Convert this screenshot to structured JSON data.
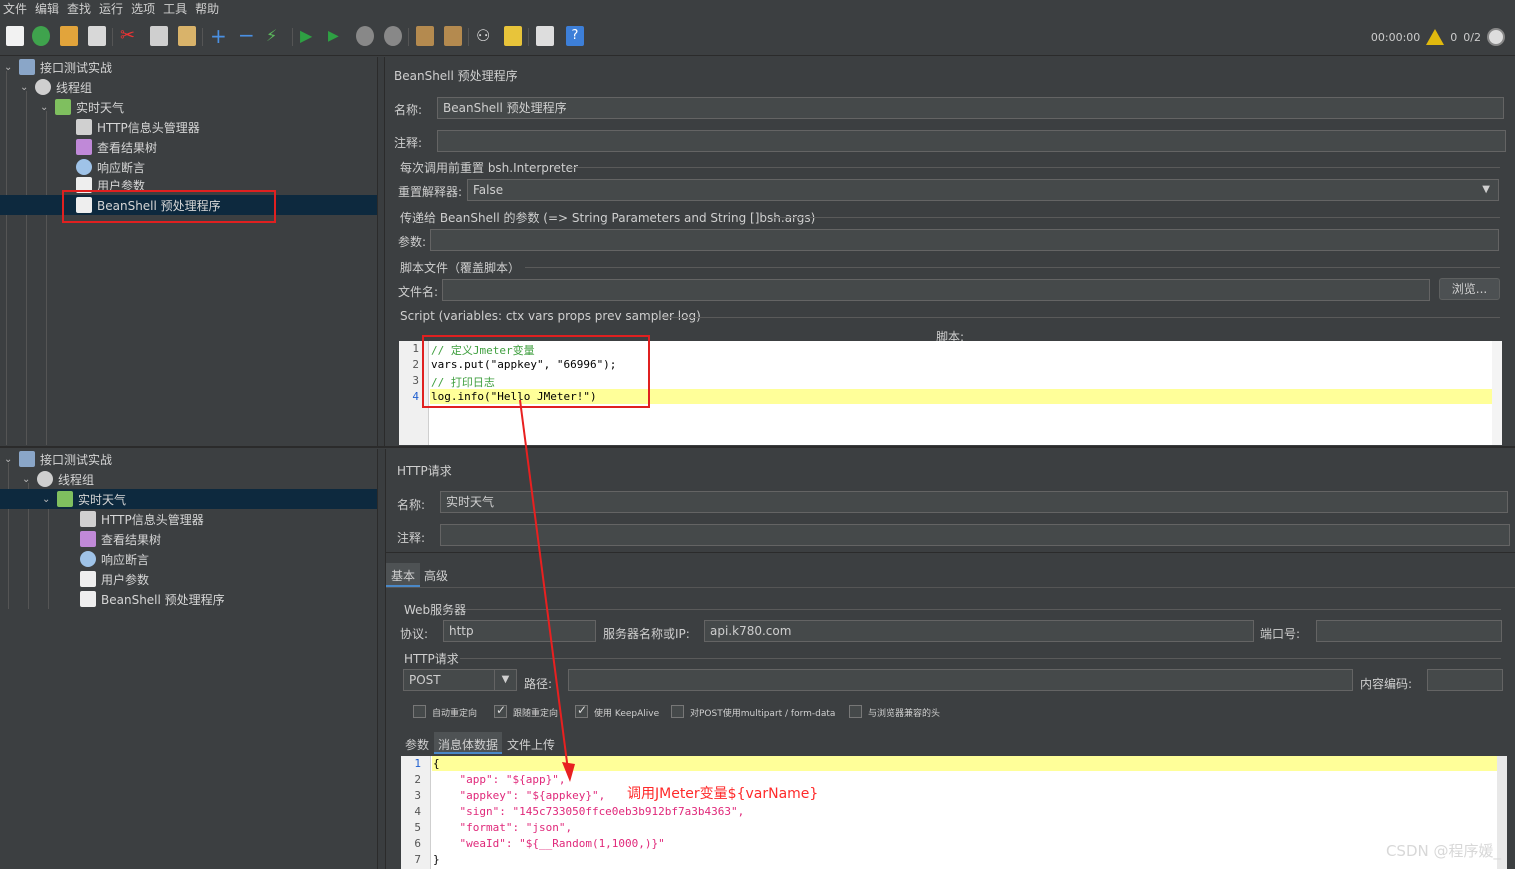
{
  "menu": [
    "文件",
    "编辑",
    "查找",
    "运行",
    "选项",
    "工具",
    "帮助"
  ],
  "toolbar": {
    "timer": "00:00:00",
    "warnings": "0",
    "threads": "0/2"
  },
  "top_tree": {
    "items": [
      {
        "label": "接口测试实战",
        "icon": "test-plan-icon"
      },
      {
        "label": "线程组",
        "icon": "gear-icon"
      },
      {
        "label": "实时天气",
        "icon": "pipette-icon"
      },
      {
        "label": "HTTP信息头管理器",
        "icon": "wrench-icon"
      },
      {
        "label": "查看结果树",
        "icon": "chart-icon"
      },
      {
        "label": "响应断言",
        "icon": "magnifier-icon"
      },
      {
        "label": "用户参数",
        "icon": "document-icon"
      },
      {
        "label": "BeanShell 预处理程序",
        "icon": "document-icon"
      }
    ]
  },
  "beanshell_panel": {
    "title": "BeanShell 预处理程序",
    "name_label": "名称:",
    "name_value": "BeanShell 预处理程序",
    "comment_label": "注释:",
    "reset_group": "每次调用前重置 bsh.Interpreter",
    "reset_label": "重置解释器:",
    "reset_value": "False",
    "params_group": "传递给 BeanShell 的参数 (=> String Parameters and String []bsh.args)",
    "params_label": "参数:",
    "file_group": "脚本文件（覆盖脚本）",
    "file_label": "文件名:",
    "browse_button": "浏览...",
    "script_group": "Script (variables: ctx vars props prev sampler log)",
    "script_label": "脚本:",
    "script_lines": [
      {
        "n": "1",
        "text": "// 定义Jmeter变量"
      },
      {
        "n": "2",
        "text": "vars.put(\"appkey\", \"66996\");"
      },
      {
        "n": "3",
        "text": "// 打印日志"
      },
      {
        "n": "4",
        "text": "log.info(\"Hello JMeter!\")"
      }
    ]
  },
  "bottom_tree": {
    "items": [
      {
        "label": "接口测试实战",
        "icon": "test-plan-icon"
      },
      {
        "label": "线程组",
        "icon": "gear-icon"
      },
      {
        "label": "实时天气",
        "icon": "pipette-icon"
      },
      {
        "label": "HTTP信息头管理器",
        "icon": "wrench-icon"
      },
      {
        "label": "查看结果树",
        "icon": "chart-icon"
      },
      {
        "label": "响应断言",
        "icon": "magnifier-icon"
      },
      {
        "label": "用户参数",
        "icon": "document-icon"
      },
      {
        "label": "BeanShell 预处理程序",
        "icon": "document-icon"
      }
    ]
  },
  "http_panel": {
    "title": "HTTP请求",
    "name_label": "名称:",
    "name_value": "实时天气",
    "comment_label": "注释:",
    "tabs": [
      "基本",
      "高级"
    ],
    "web_server_group": "Web服务器",
    "protocol_label": "协议:",
    "protocol_value": "http",
    "server_label": "服务器名称或IP:",
    "server_value": "api.k780.com",
    "port_label": "端口号:",
    "http_request_group": "HTTP请求",
    "method_value": "POST",
    "path_label": "路径:",
    "encoding_label": "内容编码:",
    "checkboxes": [
      {
        "label": "自动重定向",
        "checked": false
      },
      {
        "label": "跟随重定向",
        "checked": true
      },
      {
        "label": "使用 KeepAlive",
        "checked": true
      },
      {
        "label": "对POST使用multipart / form-data",
        "checked": false
      },
      {
        "label": "与浏览器兼容的头",
        "checked": false
      }
    ],
    "body_tabs": [
      "参数",
      "消息体数据",
      "文件上传"
    ],
    "body_lines": [
      {
        "n": "1",
        "text": "{"
      },
      {
        "n": "2",
        "text": "    \"app\": \"${app}\","
      },
      {
        "n": "3",
        "text": "    \"appkey\": \"${appkey}\","
      },
      {
        "n": "4",
        "text": "    \"sign\": \"145c733050ffce0eb3b912bf7a3b4363\","
      },
      {
        "n": "5",
        "text": "    \"format\": \"json\","
      },
      {
        "n": "6",
        "text": "    \"weaId\": \"${__Random(1,1000,)}\""
      },
      {
        "n": "7",
        "text": "}"
      }
    ]
  },
  "annotation": "调用JMeter变量${varName}",
  "watermark": "CSDN @程序媛_"
}
